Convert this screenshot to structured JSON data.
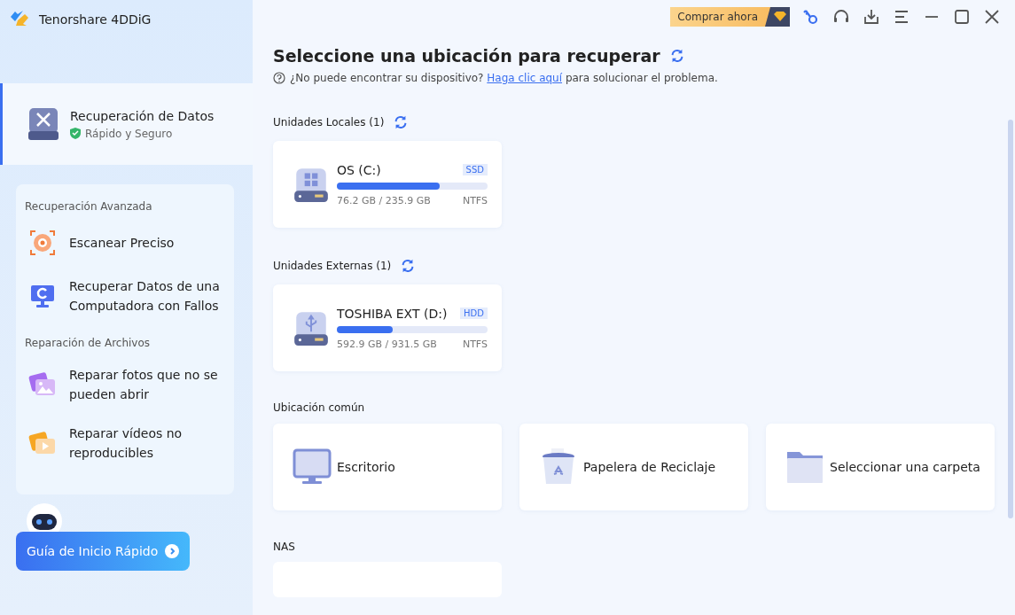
{
  "app": {
    "name": "Tenorshare 4DDiG"
  },
  "sidebar": {
    "main_item": {
      "title": "Recuperación de Datos",
      "subtitle": "Rápido y Seguro",
      "selected": true
    },
    "groups": [
      {
        "title": "Recuperación Avanzada",
        "items": [
          {
            "kind": "scan",
            "label": "Escanear Preciso",
            "selected": false
          },
          {
            "kind": "crash",
            "label": "Recuperar Datos de una Computadora con Fallos",
            "selected": false
          }
        ]
      },
      {
        "title": "Reparación de Archivos",
        "items": [
          {
            "kind": "photo",
            "label": "Reparar fotos que no se pueden abrir",
            "selected": false
          },
          {
            "kind": "video",
            "label": "Reparar vídeos no reproducibles",
            "selected": false
          }
        ]
      }
    ],
    "guide_button": "Guía de Inicio Rápido"
  },
  "toolbar": {
    "buy_button": "Comprar ahora"
  },
  "heading": "Seleccione una ubicación para recuperar",
  "help": {
    "text": "¿No puede encontrar su dispositivo?",
    "link": "Haga clic aquí",
    "after": "para solucionar el problema."
  },
  "sections": [
    {
      "title": "Unidades Locales (1)",
      "drives": [
        {
          "kind": "windows",
          "name": "OS (C:)",
          "type": "SSD",
          "usage": "76.2 GB / 235.9 GB",
          "fs": "NTFS",
          "level": 0.68
        }
      ]
    },
    {
      "title": "Unidades Externas (1)",
      "drives": [
        {
          "kind": "usb",
          "name": "TOSHIBA EXT (D:)",
          "type": "HDD",
          "usage": "592.9 GB / 931.5 GB",
          "fs": "NTFS",
          "level": 0.37
        }
      ]
    }
  ],
  "common": {
    "title": "Ubicación común",
    "items": [
      {
        "kind": "desktop",
        "label": "Escritorio"
      },
      {
        "kind": "recycle",
        "label": "Papelera de Reciclaje"
      },
      {
        "kind": "folder",
        "label": "Seleccionar una carpeta"
      }
    ]
  },
  "nas": {
    "title": "NAS"
  }
}
